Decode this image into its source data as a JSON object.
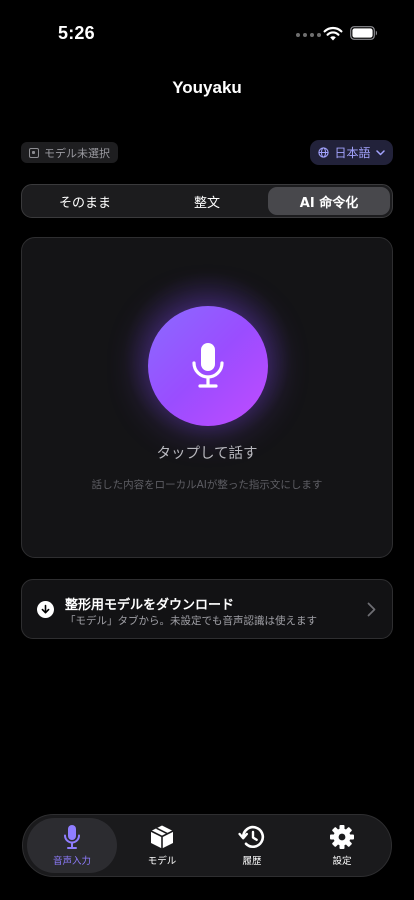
{
  "status_bar": {
    "time": "5:26"
  },
  "header": {
    "title": "Youyaku"
  },
  "model_chip": {
    "icon": "chip-icon",
    "label": "モデル未選択"
  },
  "language_selector": {
    "icon": "globe-icon",
    "label": "日本語",
    "accent_color": "#a4a4ff"
  },
  "mode_tabs": [
    {
      "label": "そのまま",
      "selected": false
    },
    {
      "label": "整文",
      "selected": false
    },
    {
      "label": "AI 命令化",
      "selected": true
    }
  ],
  "record_card": {
    "icon": "microphone-icon",
    "title": "タップして話す",
    "subtitle": "話した内容をローカルAIが整った指示文にします",
    "accent_gradient": [
      "#8a6bff",
      "#c14bff"
    ]
  },
  "download_banner": {
    "icon": "download-icon",
    "title": "整形用モデルをダウンロード",
    "subtitle": "「モデル」タブから。未設定でも音声認識は使えます"
  },
  "tab_bar": {
    "active_color": "#8f7dff",
    "items": [
      {
        "label": "音声入力",
        "icon": "microphone-icon",
        "active": true
      },
      {
        "label": "モデル",
        "icon": "cube-icon",
        "active": false
      },
      {
        "label": "履歴",
        "icon": "history-icon",
        "active": false
      },
      {
        "label": "設定",
        "icon": "gear-icon",
        "active": false
      }
    ]
  }
}
